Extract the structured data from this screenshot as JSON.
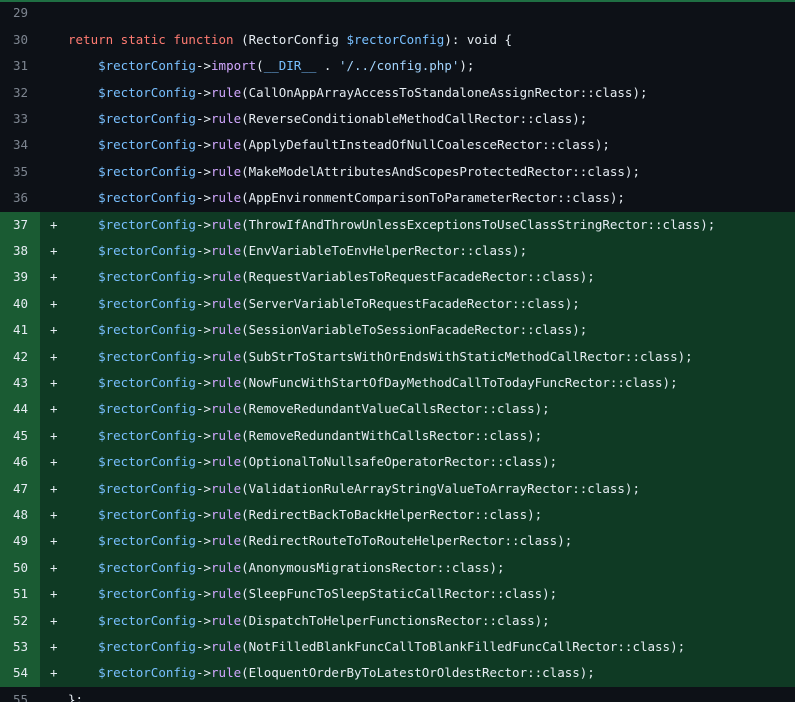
{
  "colors": {
    "background": "#0d1117",
    "added_background": "#0f3a24",
    "added_gutter": "#1a5b33",
    "keyword": "#ff7b72",
    "variable": "#79c0ff",
    "method": "#d2a8ff",
    "string": "#a5d6ff"
  },
  "lines": [
    {
      "n": "29",
      "marker": "",
      "added": false,
      "tokens": []
    },
    {
      "n": "30",
      "marker": "",
      "added": false,
      "tokens": [
        {
          "t": "kw",
          "v": "return static function"
        },
        {
          "t": "plain",
          "v": " (RectorConfig "
        },
        {
          "t": "var",
          "v": "$rectorConfig"
        },
        {
          "t": "plain",
          "v": "): void {"
        }
      ]
    },
    {
      "n": "31",
      "marker": "",
      "added": false,
      "tokens": [
        {
          "t": "plain",
          "v": "    "
        },
        {
          "t": "var",
          "v": "$rectorConfig"
        },
        {
          "t": "plain",
          "v": "->"
        },
        {
          "t": "fn",
          "v": "import"
        },
        {
          "t": "plain",
          "v": "("
        },
        {
          "t": "const",
          "v": "__DIR__"
        },
        {
          "t": "plain",
          "v": " . "
        },
        {
          "t": "str",
          "v": "'/../config.php'"
        },
        {
          "t": "plain",
          "v": ");"
        }
      ]
    },
    {
      "n": "32",
      "marker": "",
      "added": false,
      "tokens": [
        {
          "t": "plain",
          "v": "    "
        },
        {
          "t": "var",
          "v": "$rectorConfig"
        },
        {
          "t": "plain",
          "v": "->"
        },
        {
          "t": "fn",
          "v": "rule"
        },
        {
          "t": "plain",
          "v": "(CallOnAppArrayAccessToStandaloneAssignRector::class);"
        }
      ]
    },
    {
      "n": "33",
      "marker": "",
      "added": false,
      "tokens": [
        {
          "t": "plain",
          "v": "    "
        },
        {
          "t": "var",
          "v": "$rectorConfig"
        },
        {
          "t": "plain",
          "v": "->"
        },
        {
          "t": "fn",
          "v": "rule"
        },
        {
          "t": "plain",
          "v": "(ReverseConditionableMethodCallRector::class);"
        }
      ]
    },
    {
      "n": "34",
      "marker": "",
      "added": false,
      "tokens": [
        {
          "t": "plain",
          "v": "    "
        },
        {
          "t": "var",
          "v": "$rectorConfig"
        },
        {
          "t": "plain",
          "v": "->"
        },
        {
          "t": "fn",
          "v": "rule"
        },
        {
          "t": "plain",
          "v": "(ApplyDefaultInsteadOfNullCoalesceRector::class);"
        }
      ]
    },
    {
      "n": "35",
      "marker": "",
      "added": false,
      "tokens": [
        {
          "t": "plain",
          "v": "    "
        },
        {
          "t": "var",
          "v": "$rectorConfig"
        },
        {
          "t": "plain",
          "v": "->"
        },
        {
          "t": "fn",
          "v": "rule"
        },
        {
          "t": "plain",
          "v": "(MakeModelAttributesAndScopesProtectedRector::class);"
        }
      ]
    },
    {
      "n": "36",
      "marker": "",
      "added": false,
      "tokens": [
        {
          "t": "plain",
          "v": "    "
        },
        {
          "t": "var",
          "v": "$rectorConfig"
        },
        {
          "t": "plain",
          "v": "->"
        },
        {
          "t": "fn",
          "v": "rule"
        },
        {
          "t": "plain",
          "v": "(AppEnvironmentComparisonToParameterRector::class);"
        }
      ]
    },
    {
      "n": "37",
      "marker": "+",
      "added": true,
      "tokens": [
        {
          "t": "plain",
          "v": "    "
        },
        {
          "t": "var",
          "v": "$rectorConfig"
        },
        {
          "t": "plain",
          "v": "->"
        },
        {
          "t": "fn",
          "v": "rule"
        },
        {
          "t": "plain",
          "v": "(ThrowIfAndThrowUnlessExceptionsToUseClassStringRector::class);"
        }
      ]
    },
    {
      "n": "38",
      "marker": "+",
      "added": true,
      "tokens": [
        {
          "t": "plain",
          "v": "    "
        },
        {
          "t": "var",
          "v": "$rectorConfig"
        },
        {
          "t": "plain",
          "v": "->"
        },
        {
          "t": "fn",
          "v": "rule"
        },
        {
          "t": "plain",
          "v": "(EnvVariableToEnvHelperRector::class);"
        }
      ]
    },
    {
      "n": "39",
      "marker": "+",
      "added": true,
      "tokens": [
        {
          "t": "plain",
          "v": "    "
        },
        {
          "t": "var",
          "v": "$rectorConfig"
        },
        {
          "t": "plain",
          "v": "->"
        },
        {
          "t": "fn",
          "v": "rule"
        },
        {
          "t": "plain",
          "v": "(RequestVariablesToRequestFacadeRector::class);"
        }
      ]
    },
    {
      "n": "40",
      "marker": "+",
      "added": true,
      "tokens": [
        {
          "t": "plain",
          "v": "    "
        },
        {
          "t": "var",
          "v": "$rectorConfig"
        },
        {
          "t": "plain",
          "v": "->"
        },
        {
          "t": "fn",
          "v": "rule"
        },
        {
          "t": "plain",
          "v": "(ServerVariableToRequestFacadeRector::class);"
        }
      ]
    },
    {
      "n": "41",
      "marker": "+",
      "added": true,
      "tokens": [
        {
          "t": "plain",
          "v": "    "
        },
        {
          "t": "var",
          "v": "$rectorConfig"
        },
        {
          "t": "plain",
          "v": "->"
        },
        {
          "t": "fn",
          "v": "rule"
        },
        {
          "t": "plain",
          "v": "(SessionVariableToSessionFacadeRector::class);"
        }
      ]
    },
    {
      "n": "42",
      "marker": "+",
      "added": true,
      "tokens": [
        {
          "t": "plain",
          "v": "    "
        },
        {
          "t": "var",
          "v": "$rectorConfig"
        },
        {
          "t": "plain",
          "v": "->"
        },
        {
          "t": "fn",
          "v": "rule"
        },
        {
          "t": "plain",
          "v": "(SubStrToStartsWithOrEndsWithStaticMethodCallRector::class);"
        }
      ]
    },
    {
      "n": "43",
      "marker": "+",
      "added": true,
      "tokens": [
        {
          "t": "plain",
          "v": "    "
        },
        {
          "t": "var",
          "v": "$rectorConfig"
        },
        {
          "t": "plain",
          "v": "->"
        },
        {
          "t": "fn",
          "v": "rule"
        },
        {
          "t": "plain",
          "v": "(NowFuncWithStartOfDayMethodCallToTodayFuncRector::class);"
        }
      ]
    },
    {
      "n": "44",
      "marker": "+",
      "added": true,
      "tokens": [
        {
          "t": "plain",
          "v": "    "
        },
        {
          "t": "var",
          "v": "$rectorConfig"
        },
        {
          "t": "plain",
          "v": "->"
        },
        {
          "t": "fn",
          "v": "rule"
        },
        {
          "t": "plain",
          "v": "(RemoveRedundantValueCallsRector::class);"
        }
      ]
    },
    {
      "n": "45",
      "marker": "+",
      "added": true,
      "tokens": [
        {
          "t": "plain",
          "v": "    "
        },
        {
          "t": "var",
          "v": "$rectorConfig"
        },
        {
          "t": "plain",
          "v": "->"
        },
        {
          "t": "fn",
          "v": "rule"
        },
        {
          "t": "plain",
          "v": "(RemoveRedundantWithCallsRector::class);"
        }
      ]
    },
    {
      "n": "46",
      "marker": "+",
      "added": true,
      "tokens": [
        {
          "t": "plain",
          "v": "    "
        },
        {
          "t": "var",
          "v": "$rectorConfig"
        },
        {
          "t": "plain",
          "v": "->"
        },
        {
          "t": "fn",
          "v": "rule"
        },
        {
          "t": "plain",
          "v": "(OptionalToNullsafeOperatorRector::class);"
        }
      ]
    },
    {
      "n": "47",
      "marker": "+",
      "added": true,
      "tokens": [
        {
          "t": "plain",
          "v": "    "
        },
        {
          "t": "var",
          "v": "$rectorConfig"
        },
        {
          "t": "plain",
          "v": "->"
        },
        {
          "t": "fn",
          "v": "rule"
        },
        {
          "t": "plain",
          "v": "(ValidationRuleArrayStringValueToArrayRector::class);"
        }
      ]
    },
    {
      "n": "48",
      "marker": "+",
      "added": true,
      "tokens": [
        {
          "t": "plain",
          "v": "    "
        },
        {
          "t": "var",
          "v": "$rectorConfig"
        },
        {
          "t": "plain",
          "v": "->"
        },
        {
          "t": "fn",
          "v": "rule"
        },
        {
          "t": "plain",
          "v": "(RedirectBackToBackHelperRector::class);"
        }
      ]
    },
    {
      "n": "49",
      "marker": "+",
      "added": true,
      "tokens": [
        {
          "t": "plain",
          "v": "    "
        },
        {
          "t": "var",
          "v": "$rectorConfig"
        },
        {
          "t": "plain",
          "v": "->"
        },
        {
          "t": "fn",
          "v": "rule"
        },
        {
          "t": "plain",
          "v": "(RedirectRouteToToRouteHelperRector::class);"
        }
      ]
    },
    {
      "n": "50",
      "marker": "+",
      "added": true,
      "tokens": [
        {
          "t": "plain",
          "v": "    "
        },
        {
          "t": "var",
          "v": "$rectorConfig"
        },
        {
          "t": "plain",
          "v": "->"
        },
        {
          "t": "fn",
          "v": "rule"
        },
        {
          "t": "plain",
          "v": "(AnonymousMigrationsRector::class);"
        }
      ]
    },
    {
      "n": "51",
      "marker": "+",
      "added": true,
      "tokens": [
        {
          "t": "plain",
          "v": "    "
        },
        {
          "t": "var",
          "v": "$rectorConfig"
        },
        {
          "t": "plain",
          "v": "->"
        },
        {
          "t": "fn",
          "v": "rule"
        },
        {
          "t": "plain",
          "v": "(SleepFuncToSleepStaticCallRector::class);"
        }
      ]
    },
    {
      "n": "52",
      "marker": "+",
      "added": true,
      "tokens": [
        {
          "t": "plain",
          "v": "    "
        },
        {
          "t": "var",
          "v": "$rectorConfig"
        },
        {
          "t": "plain",
          "v": "->"
        },
        {
          "t": "fn",
          "v": "rule"
        },
        {
          "t": "plain",
          "v": "(DispatchToHelperFunctionsRector::class);"
        }
      ]
    },
    {
      "n": "53",
      "marker": "+",
      "added": true,
      "tokens": [
        {
          "t": "plain",
          "v": "    "
        },
        {
          "t": "var",
          "v": "$rectorConfig"
        },
        {
          "t": "plain",
          "v": "->"
        },
        {
          "t": "fn",
          "v": "rule"
        },
        {
          "t": "plain",
          "v": "(NotFilledBlankFuncCallToBlankFilledFuncCallRector::class);"
        }
      ]
    },
    {
      "n": "54",
      "marker": "+",
      "added": true,
      "tokens": [
        {
          "t": "plain",
          "v": "    "
        },
        {
          "t": "var",
          "v": "$rectorConfig"
        },
        {
          "t": "plain",
          "v": "->"
        },
        {
          "t": "fn",
          "v": "rule"
        },
        {
          "t": "plain",
          "v": "(EloquentOrderByToLatestOrOldestRector::class);"
        }
      ]
    },
    {
      "n": "55",
      "marker": "",
      "added": false,
      "tokens": [
        {
          "t": "plain",
          "v": "};"
        }
      ]
    }
  ]
}
